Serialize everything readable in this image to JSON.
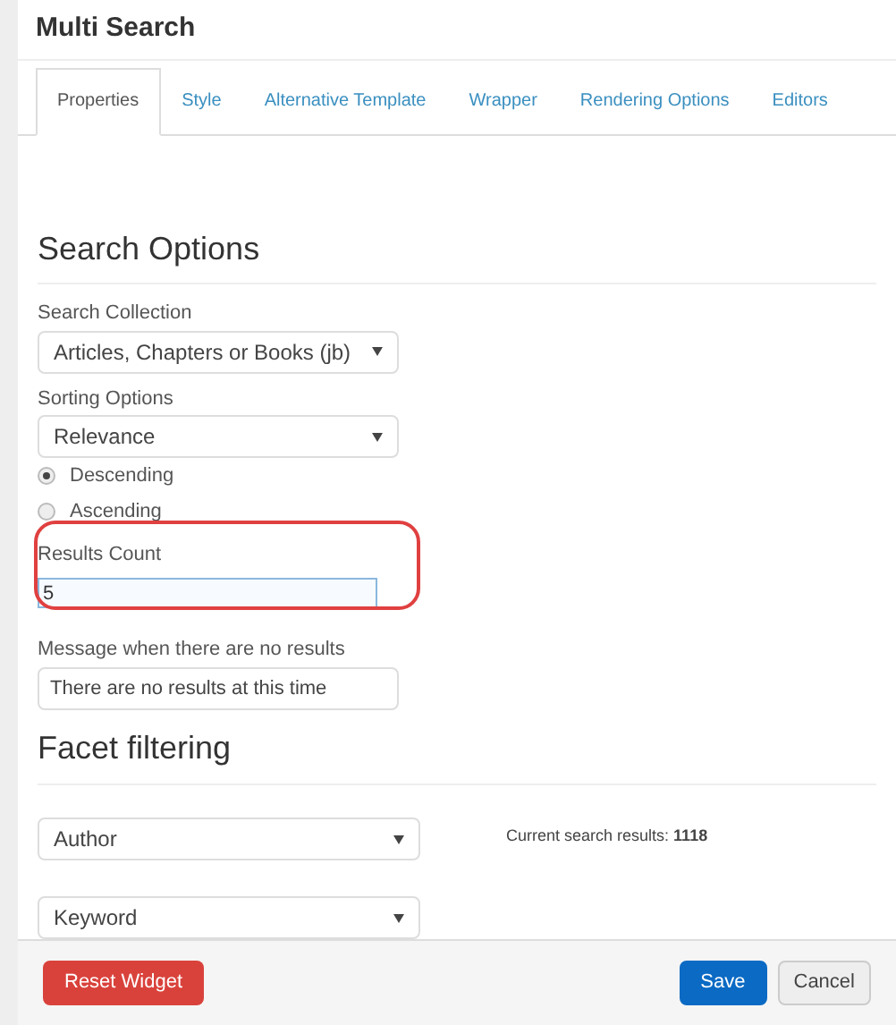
{
  "window": {
    "title": "Multi Search"
  },
  "tabs": [
    {
      "label": "Properties",
      "selected": true
    },
    {
      "label": "Style",
      "selected": false
    },
    {
      "label": "Alternative Template",
      "selected": false
    },
    {
      "label": "Wrapper",
      "selected": false
    },
    {
      "label": "Rendering Options",
      "selected": false
    },
    {
      "label": "Editors",
      "selected": false
    }
  ],
  "search_options": {
    "heading": "Search Options",
    "search_collection": {
      "label": "Search Collection",
      "value": "Articles, Chapters or Books (jb)"
    },
    "sorting_options": {
      "label": "Sorting Options",
      "value": "Relevance"
    },
    "sort_order": [
      {
        "label": "Descending",
        "selected": true
      },
      {
        "label": "Ascending",
        "selected": false
      }
    ],
    "results_count": {
      "label": "Results Count",
      "value": "5",
      "highlighted": true
    },
    "no_results_message": {
      "label": "Message when there are no results",
      "value": "There are no results at this time"
    }
  },
  "facet_filtering": {
    "heading": "Facet filtering",
    "facets": [
      {
        "value": "Author"
      },
      {
        "value": "Keyword"
      }
    ],
    "current_results": "Current search results: **1118**"
  },
  "footer": {
    "reset": "Reset Widget",
    "save": "Save",
    "cancel": "Cancel"
  }
}
